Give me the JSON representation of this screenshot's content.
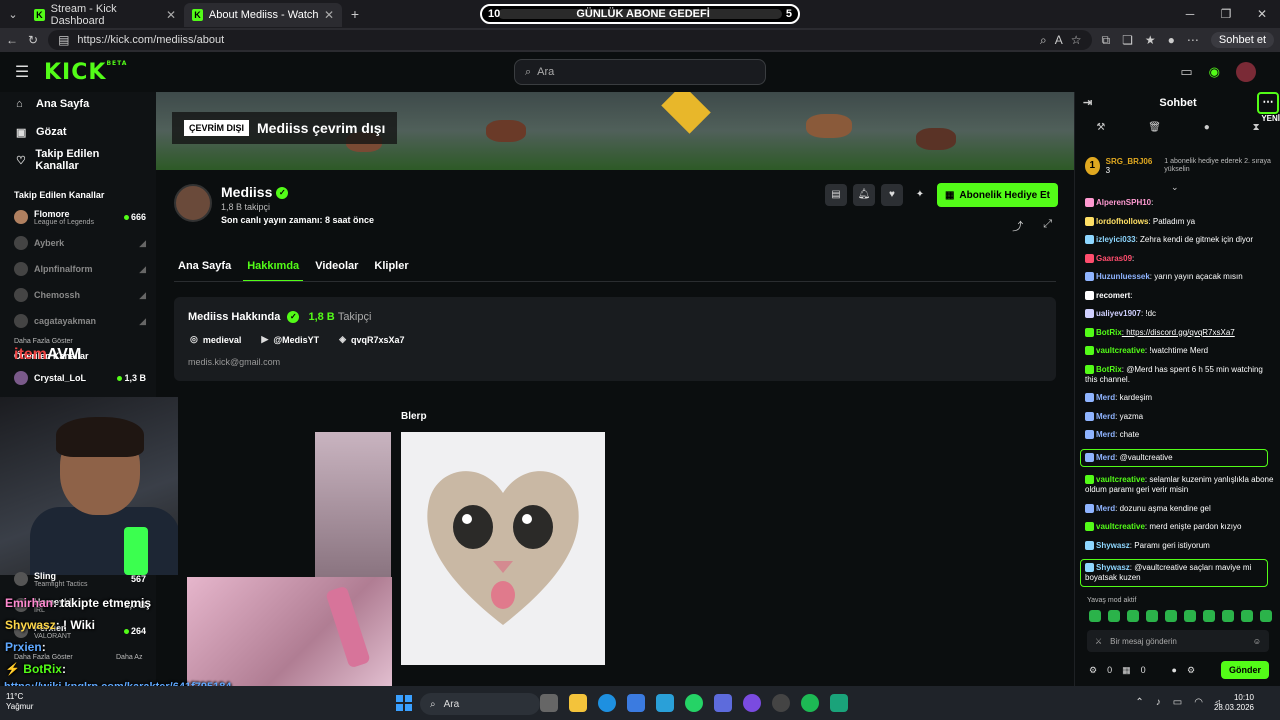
{
  "browser": {
    "tabs": [
      {
        "label": "Stream - Kick Dashboard"
      },
      {
        "label": "About Mediiss - Watch Live on Kic"
      }
    ],
    "goal": {
      "left": "10",
      "title": "GÜNLÜK ABONE GEDEFİ",
      "right": "5"
    },
    "url": "https://kick.com/mediiss/about",
    "sohbet_et": "Sohbet et"
  },
  "nav": {
    "logo": "KICK",
    "logo_beta": "BETA",
    "search_placeholder": "Ara"
  },
  "sidebar": {
    "items": [
      {
        "label": "Ana Sayfa",
        "icon": "home-icon"
      },
      {
        "label": "Gözat",
        "icon": "browse-icon"
      },
      {
        "label": "Takip Edilen Kanallar",
        "icon": "heart-icon"
      }
    ],
    "followed_title": "Takip Edilen Kanallar",
    "followed": [
      {
        "name": "Flomore",
        "sub": "League of Legends",
        "count": "666",
        "live": true
      },
      {
        "name": "Ayberk",
        "live": false
      },
      {
        "name": "Alpnfinalform",
        "live": false
      },
      {
        "name": "Chemossh",
        "live": false
      },
      {
        "name": "cagatayakman",
        "live": false
      }
    ],
    "show_more": "Daha Fazla Göster",
    "recommended_title": "Önerilen Kanallar",
    "recommended": [
      {
        "name": "Crystal_LoL",
        "count": "1,3 B"
      }
    ],
    "partial_rows": [
      {
        "name": "Sling",
        "sub": "Teamfight Tactics",
        "count": "567"
      },
      {
        "name": "Homeyki",
        "sub": "IRL",
        "count": "2,7 B"
      },
      {
        "name": "Perxien",
        "sub": "VALORANT",
        "count": "264"
      }
    ],
    "show_more_2": "Daha Fazla Göster",
    "show_less": "Daha Az"
  },
  "banner": {
    "badge": "ÇEVRİM DIŞI",
    "text": "Mediiss çevrim dışı"
  },
  "profile": {
    "name": "Mediiss",
    "followers": "1,8 B takipçi",
    "last_live": "Son canlı yayın zamanı: 8 saat önce",
    "gift_button": "Abonelik Hediye Et"
  },
  "tabs": [
    "Ana Sayfa",
    "Hakkımda",
    "Videolar",
    "Klipler"
  ],
  "about": {
    "title": "Mediiss Hakkında",
    "followers_count": "1,8 B",
    "followers_label": "Takipçi",
    "socials": [
      {
        "icon": "instagram-icon",
        "label": "medieval"
      },
      {
        "icon": "youtube-icon",
        "label": "@MedisYT"
      },
      {
        "icon": "discord-icon",
        "label": "qvqR7xsXa7"
      }
    ],
    "email": "medis.kick@gmail.com"
  },
  "blerp": {
    "title": "Blerp"
  },
  "overlay": {
    "itemavm_prefix": "item",
    "itemavm": "AVM",
    "lines": [
      {
        "user": "Emirhan",
        "text": ": takipte etmemiş"
      },
      {
        "user": "Shywasz",
        "text": ": ! Wiki"
      },
      {
        "user": "Prxien",
        "text": ":"
      },
      {
        "user": "BotRix",
        "text": ":"
      }
    ],
    "wiki_link": "https://wiki.knglrp.com/karakter/641f795184",
    "weather_temp": "11°C",
    "weather_text": "Yağmur"
  },
  "chat": {
    "title": "Sohbet",
    "new_label": "YENİ",
    "pinned": {
      "number": "1",
      "user": "SRG_BRJ06",
      "sub": "3",
      "desc": "1 abonelik hediye ederek 2. sıraya yükselin"
    },
    "messages": [
      {
        "user": "AlperenSPH10",
        "color": "#ff9ad1",
        "text": ":"
      },
      {
        "user": "lordofhollows",
        "color": "#ffe066",
        "text": ": Patladım ya"
      },
      {
        "user": "izleyici033",
        "color": "#8ed7ff",
        "text": ": Zehra kendi de gitmek için diyor"
      },
      {
        "user": "Gaaras09",
        "color": "#ff4d6d",
        "text": ":"
      },
      {
        "user": "Huzunluessek",
        "color": "#8fb4ff",
        "text": ": yarın yayın açacak mısın"
      },
      {
        "user": "recomert",
        "color": "#ffffff",
        "text": ":"
      },
      {
        "user": "ualiyev1907",
        "color": "#d0d0ff",
        "text": ": !dc"
      },
      {
        "user": "BotRix",
        "color": "#53fc18",
        "text": ": https://discord.gg/qvqR7xsXa7",
        "link": true
      },
      {
        "user": "vaultcreative",
        "color": "#53fc18",
        "text": ": !watchtime Merd"
      },
      {
        "user": "BotRix",
        "color": "#53fc18",
        "text": ": @Merd has spent 6 h 55 min watching this channel."
      },
      {
        "user": "Merd",
        "color": "#8fb4ff",
        "text": ": kardeşim"
      },
      {
        "user": "Merd",
        "color": "#8fb4ff",
        "text": ": yazma"
      },
      {
        "user": "Merd",
        "color": "#8fb4ff",
        "text": ": chate"
      },
      {
        "user": "Merd",
        "color": "#8fb4ff",
        "text": ": @vaultcreative",
        "hl": true
      },
      {
        "user": "vaultcreative",
        "color": "#53fc18",
        "text": ": selamlar kuzenim yanlışlıkla abone oldum paramı geri verir misin"
      },
      {
        "user": "Merd",
        "color": "#8fb4ff",
        "text": ": dozunu aşma kendine gel"
      },
      {
        "user": "vaultcreative",
        "color": "#53fc18",
        "text": ": merd enişte pardon kızıyo"
      },
      {
        "user": "Shywasz",
        "color": "#8ed7ff",
        "text": ": Paramı geri istiyorum"
      },
      {
        "user": "Shywasz",
        "color": "#8ed7ff",
        "text": ": @vaultcreative saçları maviye mi boyatsak kuzen",
        "hl": true
      }
    ],
    "slow_mode": "Yavaş mod aktif",
    "input_placeholder": "Bir mesaj gönderin",
    "count_a": "0",
    "count_b": "0",
    "send": "Gönder"
  },
  "taskbar": {
    "search": "Ara",
    "time": "10:10",
    "date": "28.03.2026"
  }
}
